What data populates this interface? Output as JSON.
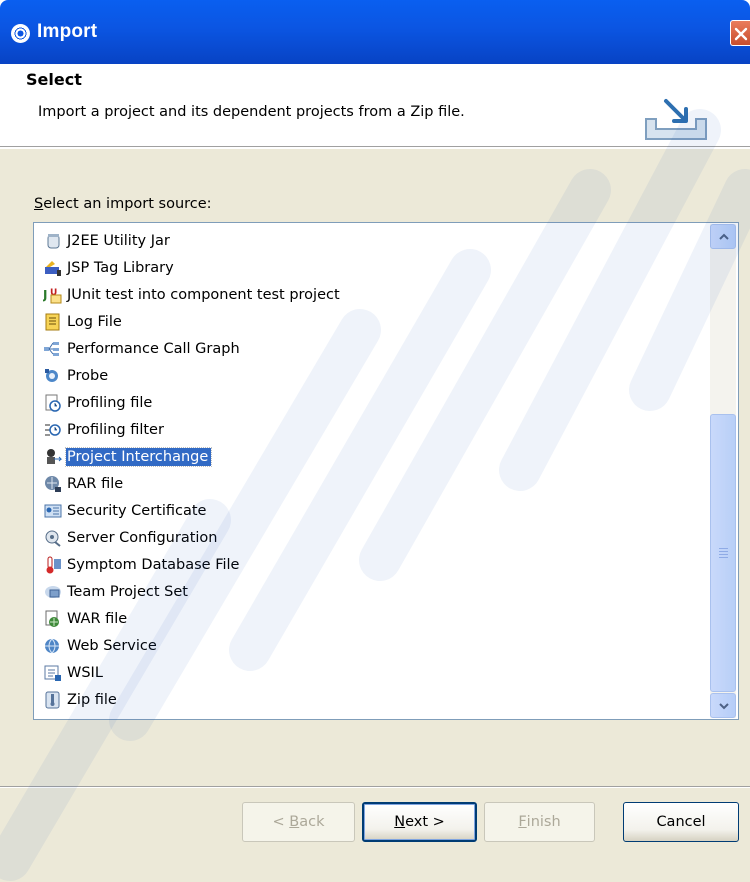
{
  "window": {
    "title": "Import",
    "close_icon": "close-icon"
  },
  "header": {
    "heading": "Select",
    "description": "Import a project and its dependent projects from a Zip file.",
    "icon": "import-wizard-icon"
  },
  "source": {
    "label_prefix": "S",
    "label_rest": "elect an import source:",
    "items": [
      {
        "label": "J2EE Utility Jar",
        "icon": "jar-icon",
        "selected": false
      },
      {
        "label": "JSP Tag Library",
        "icon": "tag-library-icon",
        "selected": false
      },
      {
        "label": "JUnit test into component test project",
        "icon": "junit-icon",
        "selected": false
      },
      {
        "label": "Log File",
        "icon": "log-file-icon",
        "selected": false
      },
      {
        "label": "Performance Call Graph",
        "icon": "call-graph-icon",
        "selected": false
      },
      {
        "label": "Probe",
        "icon": "probe-icon",
        "selected": false
      },
      {
        "label": "Profiling file",
        "icon": "profiling-file-icon",
        "selected": false
      },
      {
        "label": "Profiling filter",
        "icon": "profiling-filter-icon",
        "selected": false
      },
      {
        "label": "Project Interchange",
        "icon": "project-interchange-icon",
        "selected": true
      },
      {
        "label": "RAR file",
        "icon": "rar-file-icon",
        "selected": false
      },
      {
        "label": "Security Certificate",
        "icon": "security-certificate-icon",
        "selected": false
      },
      {
        "label": "Server Configuration",
        "icon": "server-configuration-icon",
        "selected": false
      },
      {
        "label": "Symptom Database File",
        "icon": "symptom-database-icon",
        "selected": false
      },
      {
        "label": "Team Project Set",
        "icon": "team-project-set-icon",
        "selected": false
      },
      {
        "label": "WAR file",
        "icon": "war-file-icon",
        "selected": false
      },
      {
        "label": "Web Service",
        "icon": "web-service-icon",
        "selected": false
      },
      {
        "label": "WSIL",
        "icon": "wsil-icon",
        "selected": false
      },
      {
        "label": "Zip file",
        "icon": "zip-file-icon",
        "selected": false
      }
    ]
  },
  "buttons": {
    "back": {
      "prefix": "< ",
      "mnemonic": "B",
      "rest": "ack"
    },
    "next": {
      "mnemonic": "N",
      "rest": "ext >"
    },
    "finish": {
      "mnemonic": "F",
      "rest": "inish"
    },
    "cancel": {
      "label": "Cancel"
    }
  }
}
